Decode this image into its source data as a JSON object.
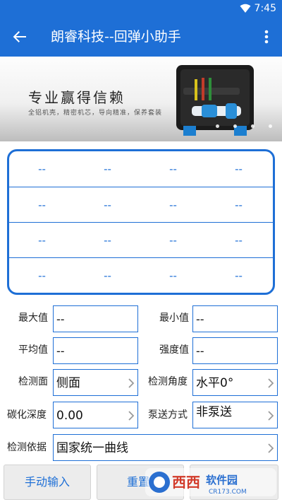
{
  "status_bar": {
    "time": "7:45",
    "wifi_icon": "wifi-icon"
  },
  "app_bar": {
    "title": "朗睿科技--回弹小助手",
    "back_icon": "arrow-back-icon",
    "menu_icon": "more-vert-icon"
  },
  "banner": {
    "slogan": "专业赢得信赖",
    "subtitle": "全铝机壳，精密机芯，导向精准，保养套装",
    "page_count": 4
  },
  "readings": {
    "rows": [
      [
        "--",
        "--",
        "--",
        "--"
      ],
      [
        "--",
        "--",
        "--",
        "--"
      ],
      [
        "--",
        "--",
        "--",
        "--"
      ],
      [
        "--",
        "--",
        "--",
        "--"
      ]
    ]
  },
  "stats": {
    "max_label": "最大值",
    "max_value": "--",
    "min_label": "最小值",
    "min_value": "--",
    "avg_label": "平均值",
    "avg_value": "--",
    "strength_label": "强度值",
    "strength_value": "--"
  },
  "settings": {
    "surface_label": "检测面",
    "surface_value": "侧面",
    "angle_label": "检测角度",
    "angle_value": "水平0°",
    "carbon_label": "碳化深度",
    "carbon_value": "0.00",
    "pump_label": "泵送方式",
    "pump_value": "非泵送",
    "basis_label": "检测依据",
    "basis_value": "国家统一曲线"
  },
  "buttons": {
    "manual_input": "手动输入",
    "reset": "重置"
  },
  "watermark": {
    "brand": "西西软件园",
    "url": "CR173.COM"
  },
  "colors": {
    "primary": "#1e6fd6",
    "button_bg": "#ececec"
  }
}
